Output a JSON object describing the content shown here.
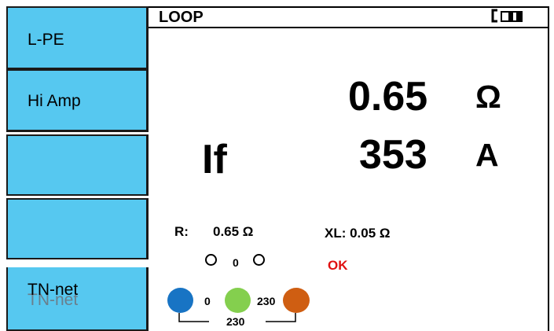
{
  "sidebar": {
    "items": [
      {
        "label": "L-PE"
      },
      {
        "label": "Hi Amp"
      },
      {
        "label": ""
      },
      {
        "label": ""
      },
      {
        "label": "TN-net",
        "ghost_label": "TN-net"
      }
    ]
  },
  "header": {
    "title": "LOOP",
    "icon": "battery-icon"
  },
  "main": {
    "impedance": {
      "value": "0.65",
      "unit": "Ω"
    },
    "fault_current": {
      "label": "If",
      "value": "353",
      "unit": "A"
    },
    "r": {
      "label": "R:",
      "value": "0.65 Ω"
    },
    "xl": {
      "label": "XL: 0.05 Ω"
    },
    "status": "OK",
    "indicator_value": "0",
    "voltages": {
      "l_pe": "0",
      "n_pe": "230",
      "l_n": "230"
    }
  },
  "colors": {
    "button_bg": "#56c8f0",
    "status_ok": "#e01010",
    "terminal_blue": "#1874c4",
    "terminal_green": "#84cf4e",
    "terminal_brown": "#cf5e12"
  }
}
